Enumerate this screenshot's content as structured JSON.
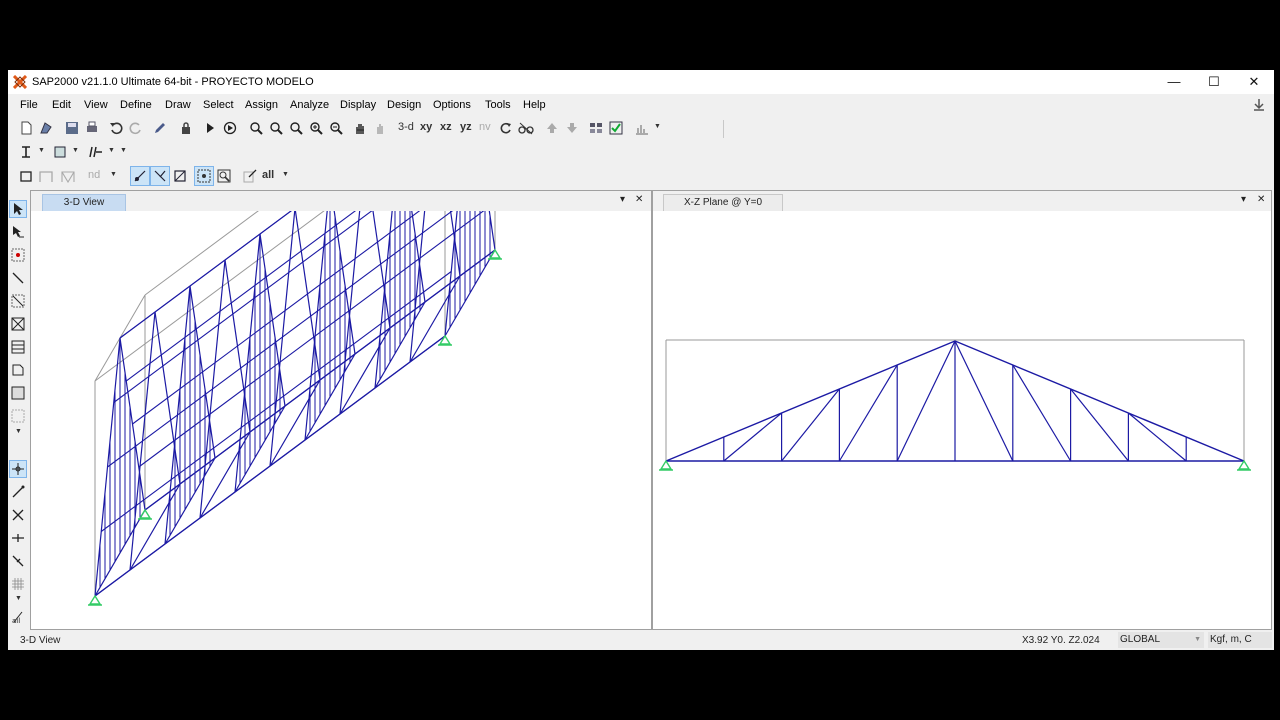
{
  "window": {
    "title": "SAP2000 v21.1.0 Ultimate 64-bit - PROYECTO MODELO",
    "minimize": "—",
    "maximize": "☐",
    "close": "✕"
  },
  "menu": [
    "File",
    "Edit",
    "View",
    "Define",
    "Draw",
    "Select",
    "Assign",
    "Analyze",
    "Display",
    "Design",
    "Options",
    "Tools",
    "Help"
  ],
  "toolbar": {
    "view_3d": "3-d",
    "view_xy": "xy",
    "view_xz": "xz",
    "view_yz": "yz",
    "view_nv": "nv",
    "nd_label": "nd",
    "all_label": "all"
  },
  "panes": {
    "left": {
      "tab": "3-D View"
    },
    "right": {
      "tab": "X-Z Plane @ Y=0"
    },
    "dropdown": "▾",
    "close": "✕"
  },
  "status": {
    "left": "3-D View",
    "coords": "X3.92  Y0.  Z2.024",
    "coord_system": "GLOBAL",
    "units": "Kgf, m, C"
  },
  "colors": {
    "frame": "#1c1aa4",
    "bounding_box": "#9a9a9a",
    "support": "#33cc66"
  }
}
